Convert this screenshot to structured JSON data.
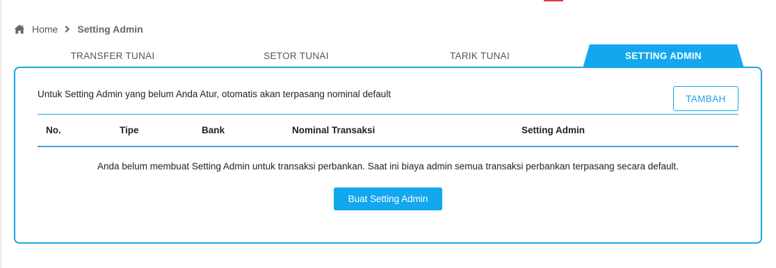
{
  "breadcrumb": {
    "icon": "home-icon",
    "home_label": "Home",
    "separator_icon": "chevron-right-icon",
    "current": "Setting Admin"
  },
  "tabs": [
    {
      "label": "TRANSFER TUNAI",
      "active": false
    },
    {
      "label": "SETOR TUNAI",
      "active": false
    },
    {
      "label": "TARIK TUNAI",
      "active": false
    },
    {
      "label": "SETTING ADMIN",
      "active": true
    }
  ],
  "panel": {
    "info_text": "Untuk Setting Admin yang belum Anda Atur, otomatis akan terpasang nominal default",
    "add_button_label": "TAMBAH",
    "table_headers": [
      "No.",
      "Tipe",
      "Bank",
      "Nominal Transaksi",
      "Setting Admin"
    ],
    "empty_message": "Anda belum membuat Setting Admin untuk transaksi perbankan. Saat ini biaya admin semua transaksi perbankan terpasang secara default.",
    "create_button_label": "Buat Setting Admin"
  },
  "colors": {
    "accent": "#1aa3e8",
    "button_fill": "#12a7ef",
    "active_tab": "#12a7ef",
    "top_mark": "#e03a3a"
  }
}
